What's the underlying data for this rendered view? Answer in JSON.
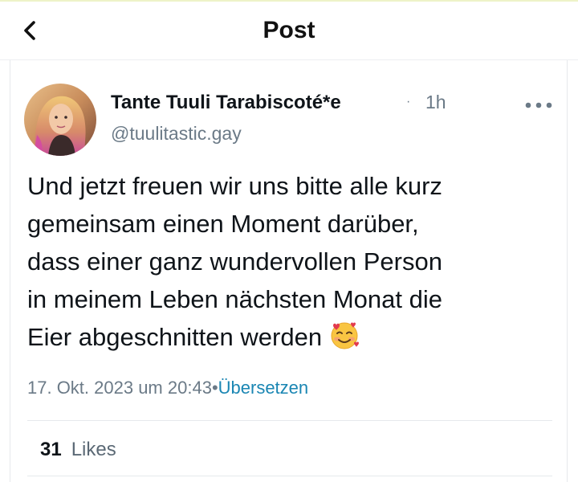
{
  "header": {
    "title": "Post",
    "back_icon": "chevron-left-icon"
  },
  "post": {
    "author": {
      "display_name": "Tante Tuuli Tarabiscoté*e",
      "handle": "@tuulitastic.gay"
    },
    "relative_time": "1h",
    "separator": "·",
    "more_icon": "more-horizontal-icon",
    "text_lines": [
      "Und jetzt freuen wir uns bitte alle kurz",
      "gemeinsam einen Moment darüber,",
      "dass einer ganz wundervollen Person",
      "in meinem Leben nächsten Monat die",
      "Eier abgeschnitten werden"
    ],
    "emoji": "smiling-face-with-hearts",
    "timestamp": "17. Okt. 2023 um 20:43",
    "meta_separator": "•",
    "translate_label": "Übersetzen",
    "likes": {
      "count": "31",
      "label": "Likes"
    }
  },
  "colors": {
    "muted": "#6b7a87",
    "link": "#1a86b3",
    "text": "#0f1419",
    "border": "#e6e9ec"
  }
}
